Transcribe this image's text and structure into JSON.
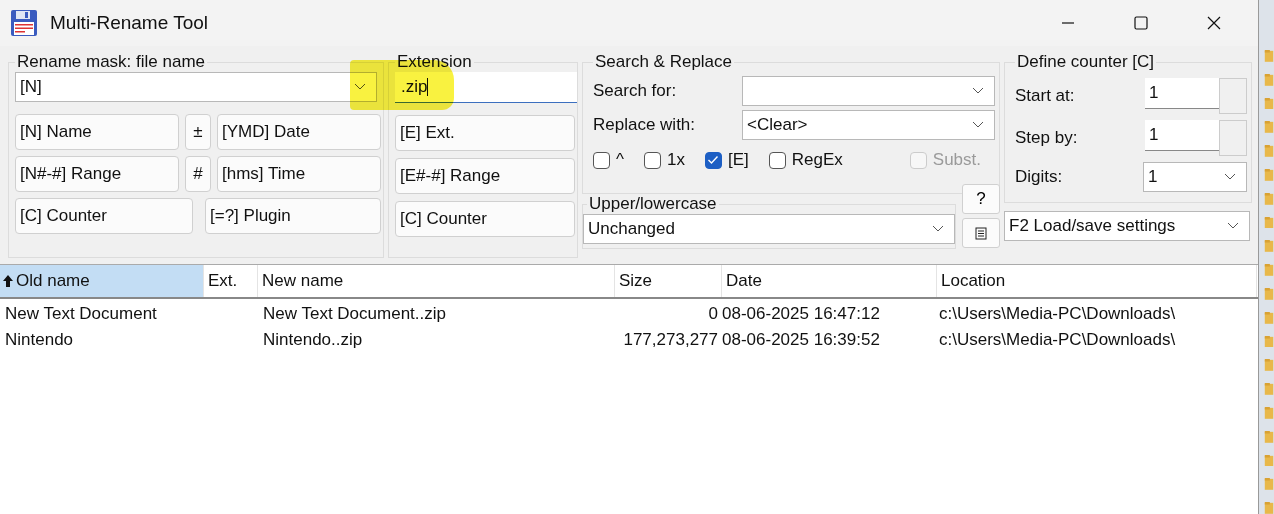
{
  "window": {
    "title": "Multi-Rename Tool"
  },
  "rename_mask": {
    "title": "Rename mask: file name",
    "value": "[N]",
    "buttons": [
      {
        "label": "[N]  Name",
        "kind": "wide"
      },
      {
        "label": "±",
        "kind": "narrow"
      },
      {
        "label": "[YMD]  Date",
        "kind": "wide"
      },
      {
        "label": "[N#-#] Range",
        "kind": "wide"
      },
      {
        "label": "#",
        "kind": "narrow"
      },
      {
        "label": "[hms]  Time",
        "kind": "wide"
      },
      {
        "label": "[C]  Counter",
        "kind": "half"
      },
      {
        "label": "[=?]  Plugin",
        "kind": "half"
      }
    ]
  },
  "extension": {
    "title": "Extension",
    "value": ".zip",
    "buttons": [
      "[E]  Ext.",
      "[E#-#] Range",
      "[C]  Counter"
    ]
  },
  "search_replace": {
    "title": "Search & Replace",
    "search_label": "Search for:",
    "replace_label": "Replace with:",
    "replace_value": "<Clear>",
    "options": [
      {
        "label": "^",
        "checked": false,
        "disabled": false
      },
      {
        "label": "1x",
        "checked": false,
        "disabled": false
      },
      {
        "label": "[E]",
        "checked": true,
        "disabled": false
      },
      {
        "label": "RegEx",
        "checked": false,
        "disabled": false
      },
      {
        "label": "Subst.",
        "checked": false,
        "disabled": true
      }
    ]
  },
  "case": {
    "title": "Upper/lowercase",
    "value": "Unchanged",
    "help_button": "?"
  },
  "counter": {
    "title": "Define counter [C]",
    "start_label": "Start at:",
    "start": "1",
    "step_label": "Step by:",
    "step": "1",
    "digits_label": "Digits:",
    "digits": "1"
  },
  "settings": {
    "value": "F2 Load/save settings"
  },
  "table": {
    "columns": [
      {
        "label": "Old name",
        "selected": true
      },
      {
        "label": "Ext.",
        "selected": false
      },
      {
        "label": "New name",
        "selected": false
      },
      {
        "label": "Size",
        "selected": false
      },
      {
        "label": "Date",
        "selected": false
      },
      {
        "label": "Location",
        "selected": false
      }
    ],
    "rows": [
      [
        "New Text Document",
        "",
        "New Text Document..zip",
        "0",
        "08-06-2025 16:47:12",
        "c:\\Users\\Media-PC\\Downloads\\"
      ],
      [
        "Nintendo",
        "",
        "Nintendo..zip",
        "177,273,277",
        "08-06-2025 16:39:52",
        "c:\\Users\\Media-PC\\Downloads\\"
      ]
    ]
  }
}
